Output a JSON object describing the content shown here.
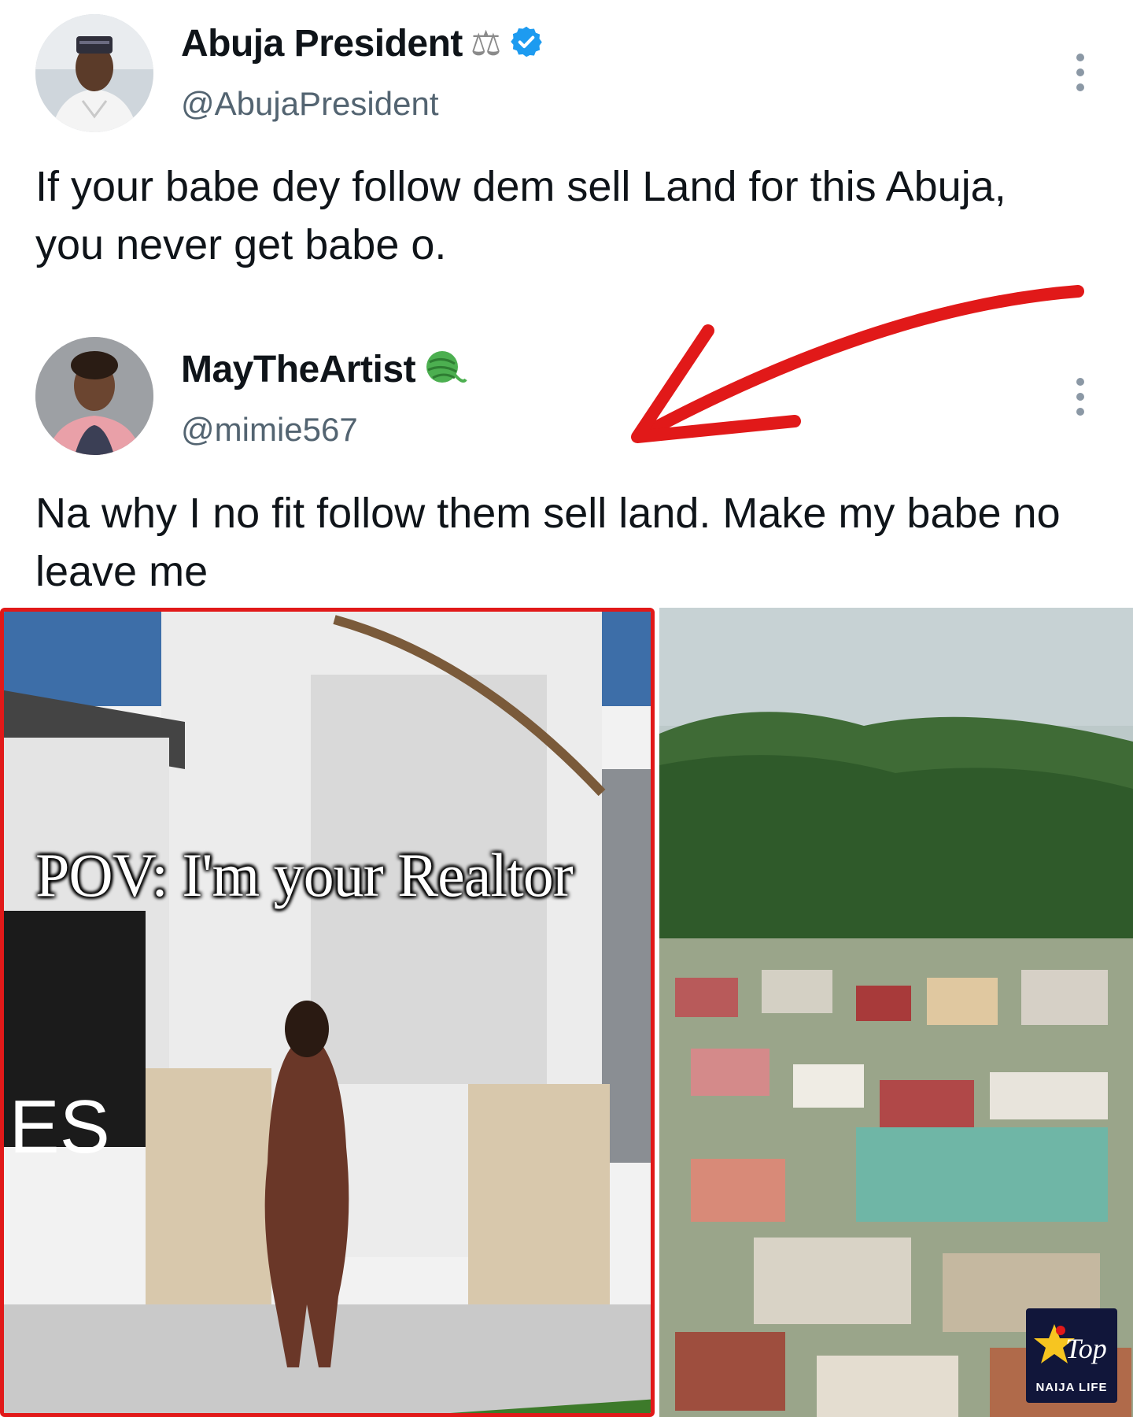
{
  "post_primary": {
    "display_name": "Abuja President",
    "badge_emoji": "⚖",
    "verified_icon": "verified-badge-icon",
    "handle": "@AbujaPresident",
    "text": "If your babe dey follow dem sell Land for this Abuja, you never get babe o."
  },
  "post_reply": {
    "display_name": "MayTheArtist",
    "badge_icon": "yarn-ball-icon",
    "handle": "@mimie567",
    "text": "Na why I no fit follow them sell land. Make my babe no leave me"
  },
  "media": {
    "left_caption": "POV: I'm your Realtor",
    "left_sign_fragment": "IES",
    "watermark_top": "Top",
    "watermark_bottom": "NAIJA LIFE"
  },
  "colors": {
    "verified": "#1d9bf0",
    "arrow": "#e11919",
    "handle_gray": "#536471"
  }
}
